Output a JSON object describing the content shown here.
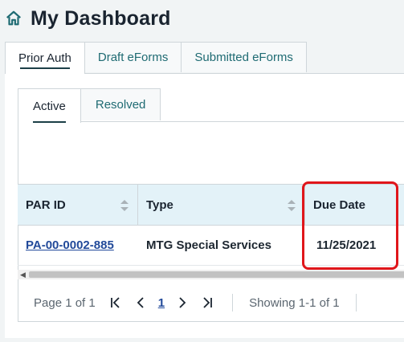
{
  "header": {
    "title": "My Dashboard",
    "icon": "home-icon"
  },
  "outer_tabs": [
    {
      "label": "Prior Auth",
      "active": true
    },
    {
      "label": "Draft eForms",
      "active": false
    },
    {
      "label": "Submitted eForms",
      "active": false
    }
  ],
  "inner_tabs": [
    {
      "label": "Active",
      "active": true
    },
    {
      "label": "Resolved",
      "active": false
    }
  ],
  "table": {
    "columns": [
      "PAR ID",
      "Type",
      "Due Date"
    ],
    "rows": [
      {
        "par_id": "PA-00-0002-885",
        "type": "MTG Special Services",
        "due_date": "11/25/2021"
      }
    ]
  },
  "pager": {
    "page_info": "Page 1 of 1",
    "first": "|<",
    "prev": "<",
    "current": "1",
    "next": ">",
    "last": ">|",
    "showing": "Showing 1-1 of 1"
  },
  "colors": {
    "accent": "#1f6b73",
    "link": "#224a9a",
    "highlight": "#e0161b",
    "header_bg": "#e3f2f8"
  }
}
